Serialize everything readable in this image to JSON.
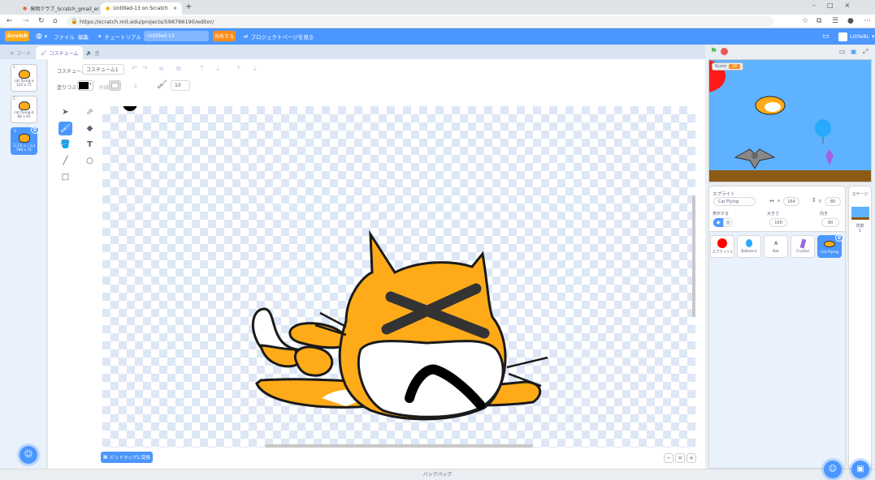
{
  "browser": {
    "tabs": [
      {
        "label": "発明クラブ_Scratch_gmail_engli",
        "active": false
      },
      {
        "label": "Untitled-13 on Scratch",
        "active": true
      }
    ],
    "new_tab": "+",
    "url": "https://scratch.mit.edu/projects/598786190/editor/"
  },
  "menu": {
    "logo": "Scratch",
    "language_icon": "globe-icon",
    "file": "ファイル",
    "edit": "編集",
    "tutorials": "チュートリアル",
    "project_title": "Untitled-13",
    "share": "共有する",
    "project_page": "プロジェクトページを見る",
    "user": "Little8L"
  },
  "editor_tabs": {
    "code": "コード",
    "costumes": "コスチューム",
    "sounds": "音"
  },
  "costumes": [
    {
      "num": "1",
      "name": "cat flying-a",
      "size": "125 x 71"
    },
    {
      "num": "2",
      "name": "cat flying-b",
      "size": "88 x 91"
    },
    {
      "num": "3",
      "name": "コスチューム1",
      "size": "186 x 71",
      "selected": true
    }
  ],
  "paint": {
    "costume_label": "コスチューム",
    "costume_name": "コスチューム1",
    "fill_label": "塗りつぶし",
    "outline_label": "枠線",
    "outline_value": "2",
    "brush_size": "10",
    "fill_color": "#000000",
    "convert_button": "ビットマップに変換"
  },
  "backpack": "バックパック",
  "stage": {
    "score_label": "Score",
    "score_value": "20"
  },
  "sprite_info": {
    "label": "スプライト",
    "name": "Cat Flying",
    "x_label": "x",
    "x": "164",
    "y_label": "y",
    "y": "80",
    "show_label": "表示する",
    "size_label": "大きさ",
    "size": "100",
    "direction_label": "向き",
    "direction": "90"
  },
  "sprites": [
    {
      "name": "スプライト1",
      "color": "#ff0000"
    },
    {
      "name": "Balloon1",
      "color": "#29aaff"
    },
    {
      "name": "Bat",
      "color": "#555555"
    },
    {
      "name": "Crystal",
      "color": "#a064e0"
    },
    {
      "name": "Cat Flying",
      "color": "#ffab19",
      "selected": true
    }
  ],
  "stage_panel": {
    "title": "ステージ",
    "backdrops_label": "背景",
    "backdrops_count": "1"
  }
}
